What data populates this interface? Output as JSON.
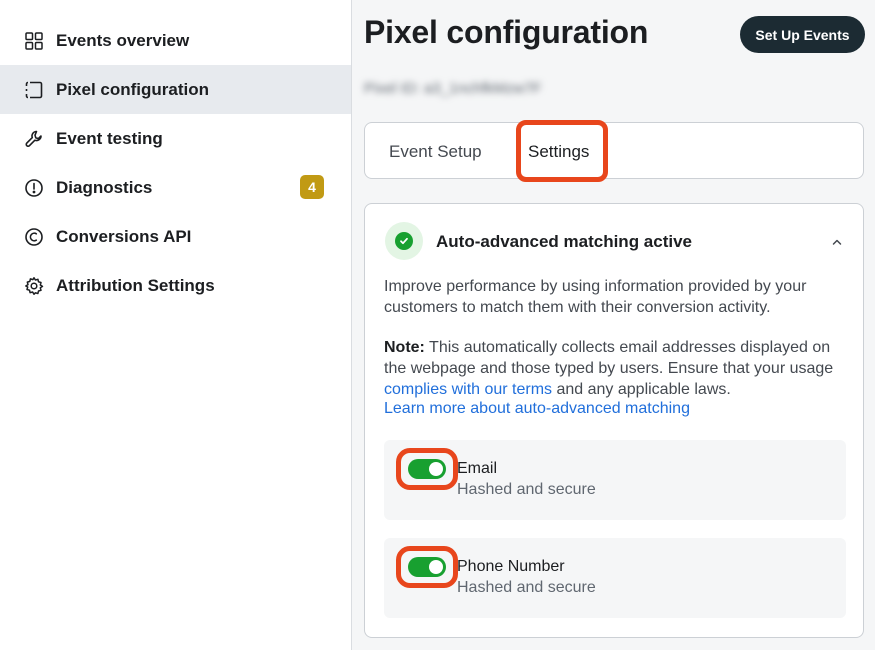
{
  "sidebar": {
    "items": [
      {
        "label": "Events overview",
        "icon": "grid-icon"
      },
      {
        "label": "Pixel configuration",
        "icon": "pixel-frame-icon",
        "active": true
      },
      {
        "label": "Event testing",
        "icon": "wrench-icon"
      },
      {
        "label": "Diagnostics",
        "icon": "alert-circle-icon",
        "badge": "4"
      },
      {
        "label": "Conversions API",
        "icon": "conversions-icon"
      },
      {
        "label": "Attribution Settings",
        "icon": "gear-icon"
      }
    ]
  },
  "header": {
    "title": "Pixel configuration",
    "setup_button": "Set Up Events",
    "pixel_id": "Pixel ID: a3_1nchfkMzw7F"
  },
  "tabs": [
    {
      "label": "Event Setup"
    },
    {
      "label": "Settings",
      "selected": true
    }
  ],
  "panel": {
    "title": "Auto-advanced matching active",
    "description": "Improve performance by using information provided by your customers to match them with their conversion activity.",
    "note_label": "Note:",
    "note_text_1": " This automatically collects email addresses displayed on the webpage and those typed by users. Ensure that your usage ",
    "terms_link": "complies with our terms",
    "note_text_2": " and any applicable laws.",
    "learn_more_link": "Learn more about auto-advanced matching",
    "options": [
      {
        "title": "Email",
        "subtitle": "Hashed and secure",
        "enabled": true
      },
      {
        "title": "Phone Number",
        "subtitle": "Hashed and secure",
        "enabled": true
      }
    ]
  },
  "colors": {
    "accent_green": "#18a030",
    "highlight_orange": "#e8461c",
    "badge_gold": "#c19a14",
    "link_blue": "#216fdb",
    "dark_button": "#1c2b33"
  }
}
